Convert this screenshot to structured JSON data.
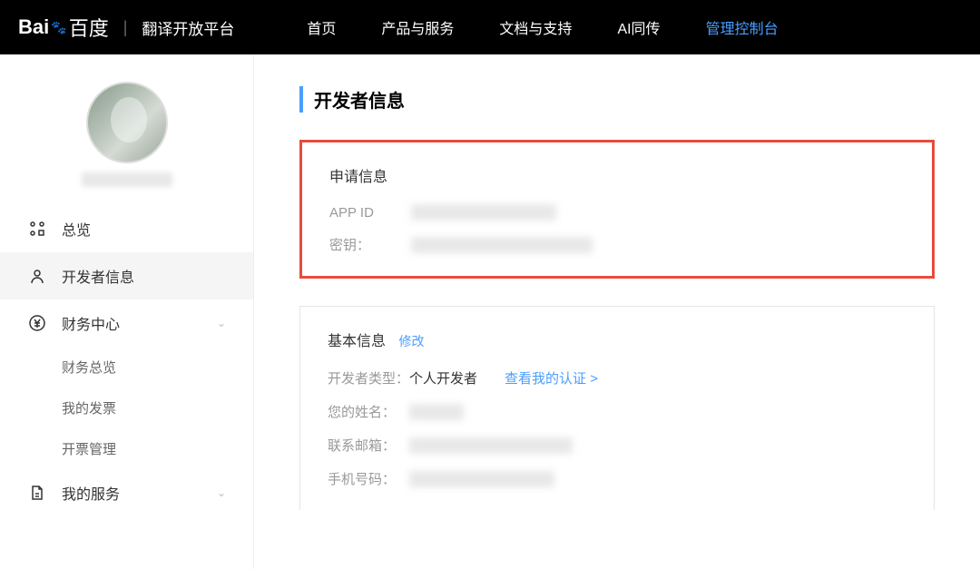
{
  "header": {
    "logo_text": "Bai",
    "logo_text2": "百度",
    "platform": "翻译开放平台",
    "nav": [
      {
        "label": "首页",
        "active": false
      },
      {
        "label": "产品与服务",
        "active": false
      },
      {
        "label": "文档与支持",
        "active": false
      },
      {
        "label": "AI同传",
        "active": false
      },
      {
        "label": "管理控制台",
        "active": true
      }
    ]
  },
  "sidebar": {
    "menu": [
      {
        "label": "总览",
        "icon": "grid"
      },
      {
        "label": "开发者信息",
        "icon": "user",
        "selected": true
      },
      {
        "label": "财务中心",
        "icon": "currency",
        "expandable": true,
        "expanded": true
      },
      {
        "label": "我的服务",
        "icon": "document",
        "expandable": true
      }
    ],
    "submenu_finance": [
      {
        "label": "财务总览"
      },
      {
        "label": "我的发票"
      },
      {
        "label": "开票管理"
      }
    ]
  },
  "content": {
    "page_title": "开发者信息",
    "application_info": {
      "title": "申请信息",
      "app_id_label": "APP ID",
      "secret_label": "密钥："
    },
    "basic_info": {
      "title": "基本信息",
      "edit_label": "修改",
      "developer_type_label": "开发者类型：",
      "developer_type_value": "个人开发者",
      "view_auth_label": "查看我的认证 >",
      "name_label": "您的姓名：",
      "email_label": "联系邮箱：",
      "phone_label": "手机号码："
    }
  }
}
